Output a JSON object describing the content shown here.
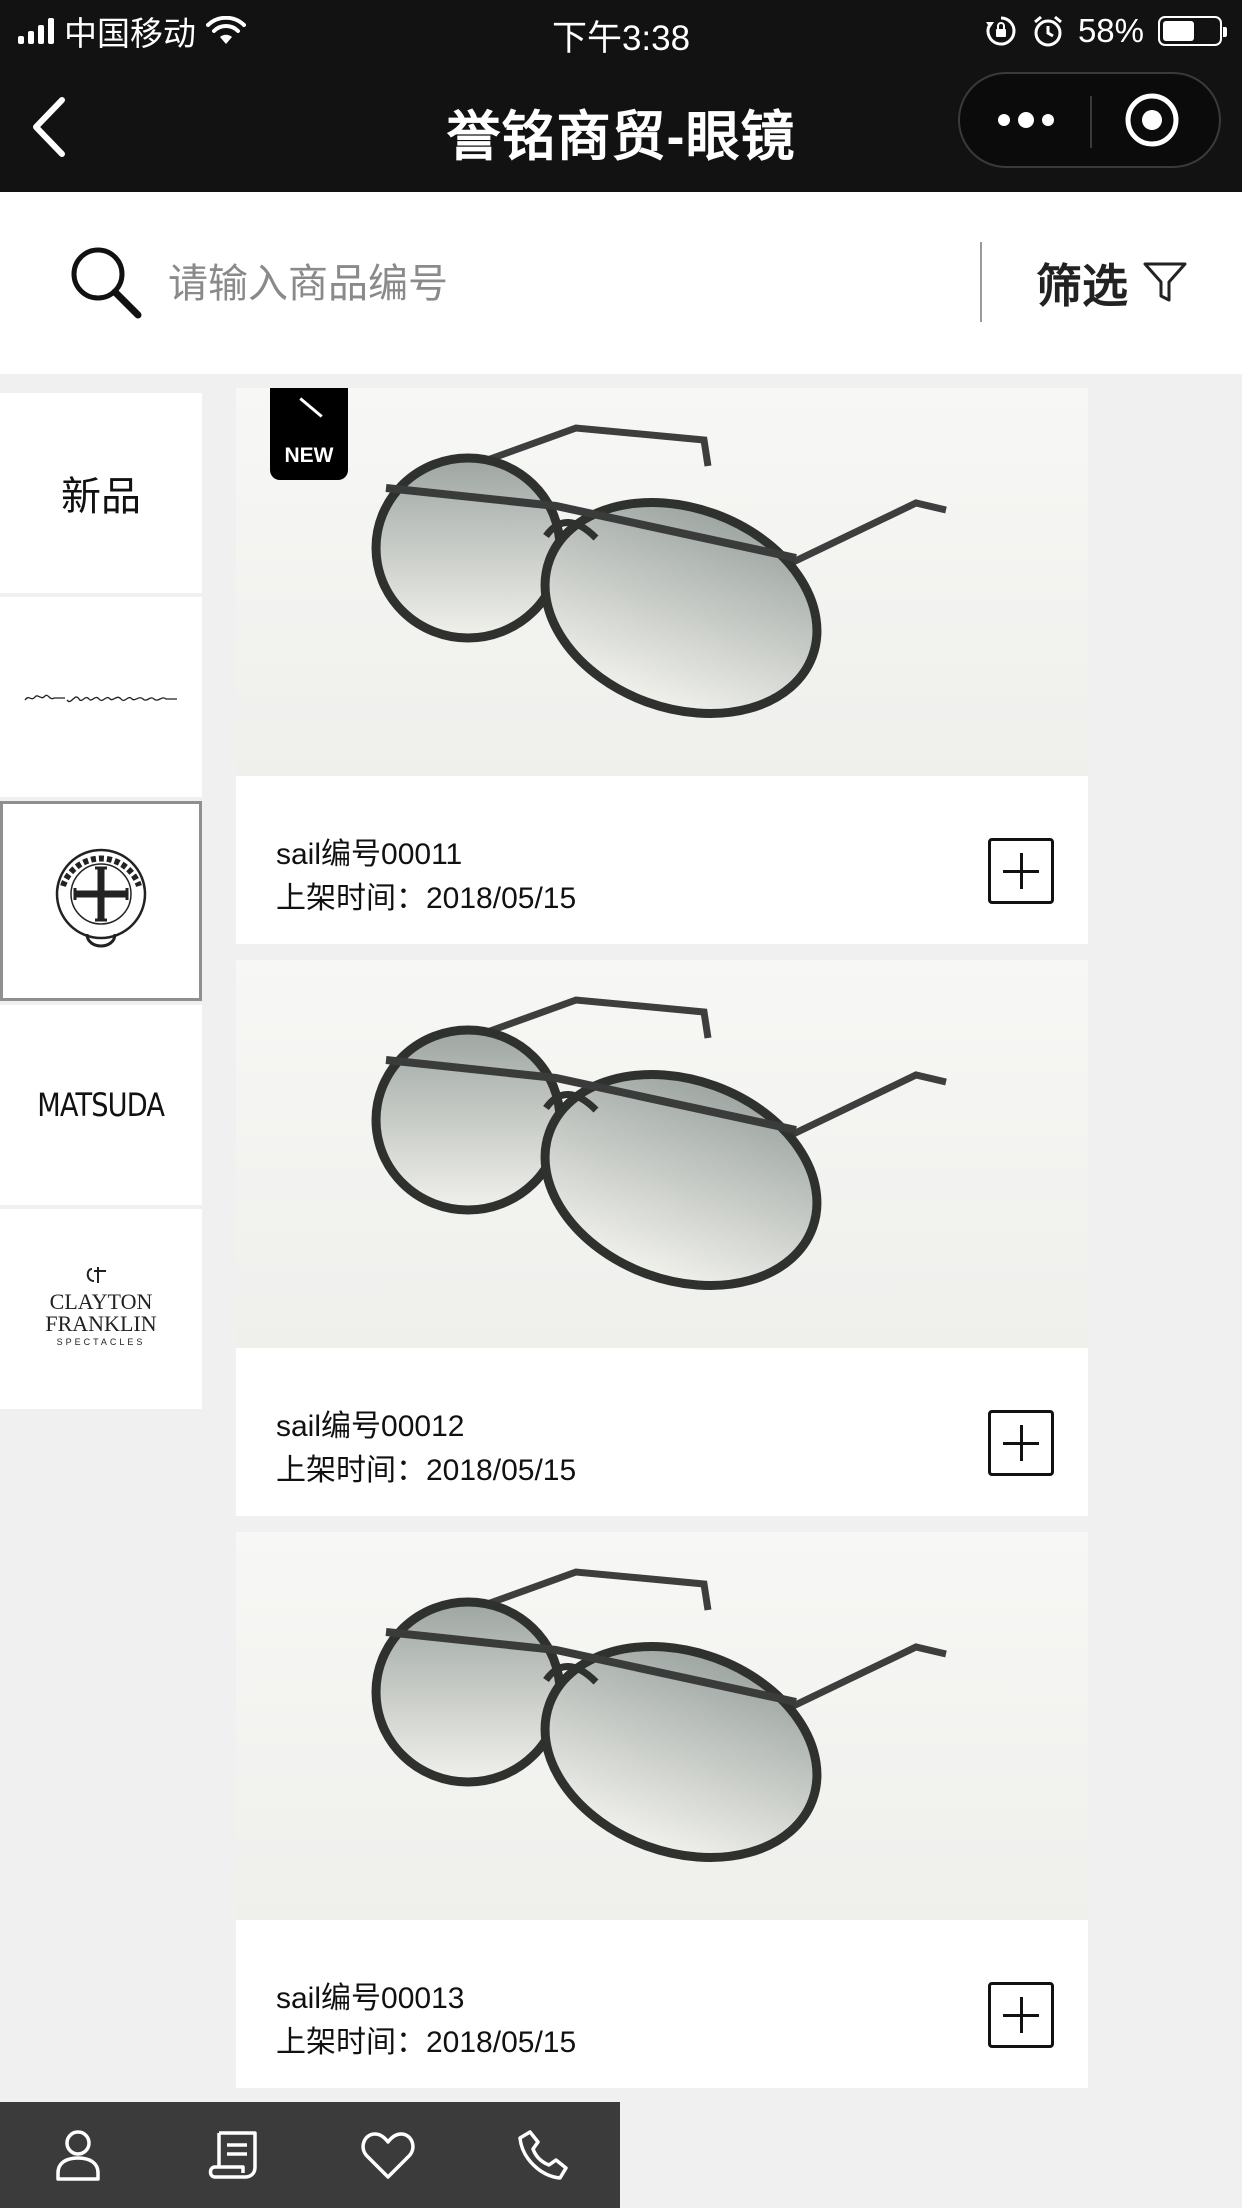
{
  "status_bar": {
    "carrier": "中国移动",
    "time": "下午3:38",
    "battery": "58%",
    "battery_level": 0.58
  },
  "nav": {
    "title": "誉铭商贸-眼镜",
    "back_icon": "chevron-left-icon",
    "more_icon": "more-dots-icon",
    "close_icon": "miniprogram-close-icon"
  },
  "search": {
    "placeholder": "请输入商品编号",
    "value": "",
    "filter_label": "筛选",
    "filter_icon": "funnel-icon"
  },
  "sidebar": {
    "items": [
      {
        "label": "新品",
        "kind": "text",
        "active": false
      },
      {
        "label": "Italia Independent",
        "kind": "logo",
        "active": false
      },
      {
        "label": "CHROME HEARTS",
        "kind": "logo",
        "active": true
      },
      {
        "label": "MATSUDA",
        "kind": "logo",
        "active": false
      },
      {
        "label": "CLAYTON FRANKLIN SPECTACLES",
        "kind": "logo",
        "active": false
      }
    ]
  },
  "products": [
    {
      "code": "sail编号00011",
      "date": "上架时间：2018/05/15",
      "new": true,
      "badge": "NEW"
    },
    {
      "code": "sail编号00012",
      "date": "上架时间：2018/05/15",
      "new": false
    },
    {
      "code": "sail编号00013",
      "date": "上架时间：2018/05/15",
      "new": false
    }
  ],
  "tabbar": {
    "tabs": [
      {
        "icon": "user-icon"
      },
      {
        "icon": "receipt-icon"
      },
      {
        "icon": "heart-icon"
      },
      {
        "icon": "phone-icon"
      }
    ]
  },
  "colors": {
    "nav_bg": "#121212",
    "page_bg": "#f0f0f0",
    "tabbar_bg": "#3b3b3b"
  }
}
